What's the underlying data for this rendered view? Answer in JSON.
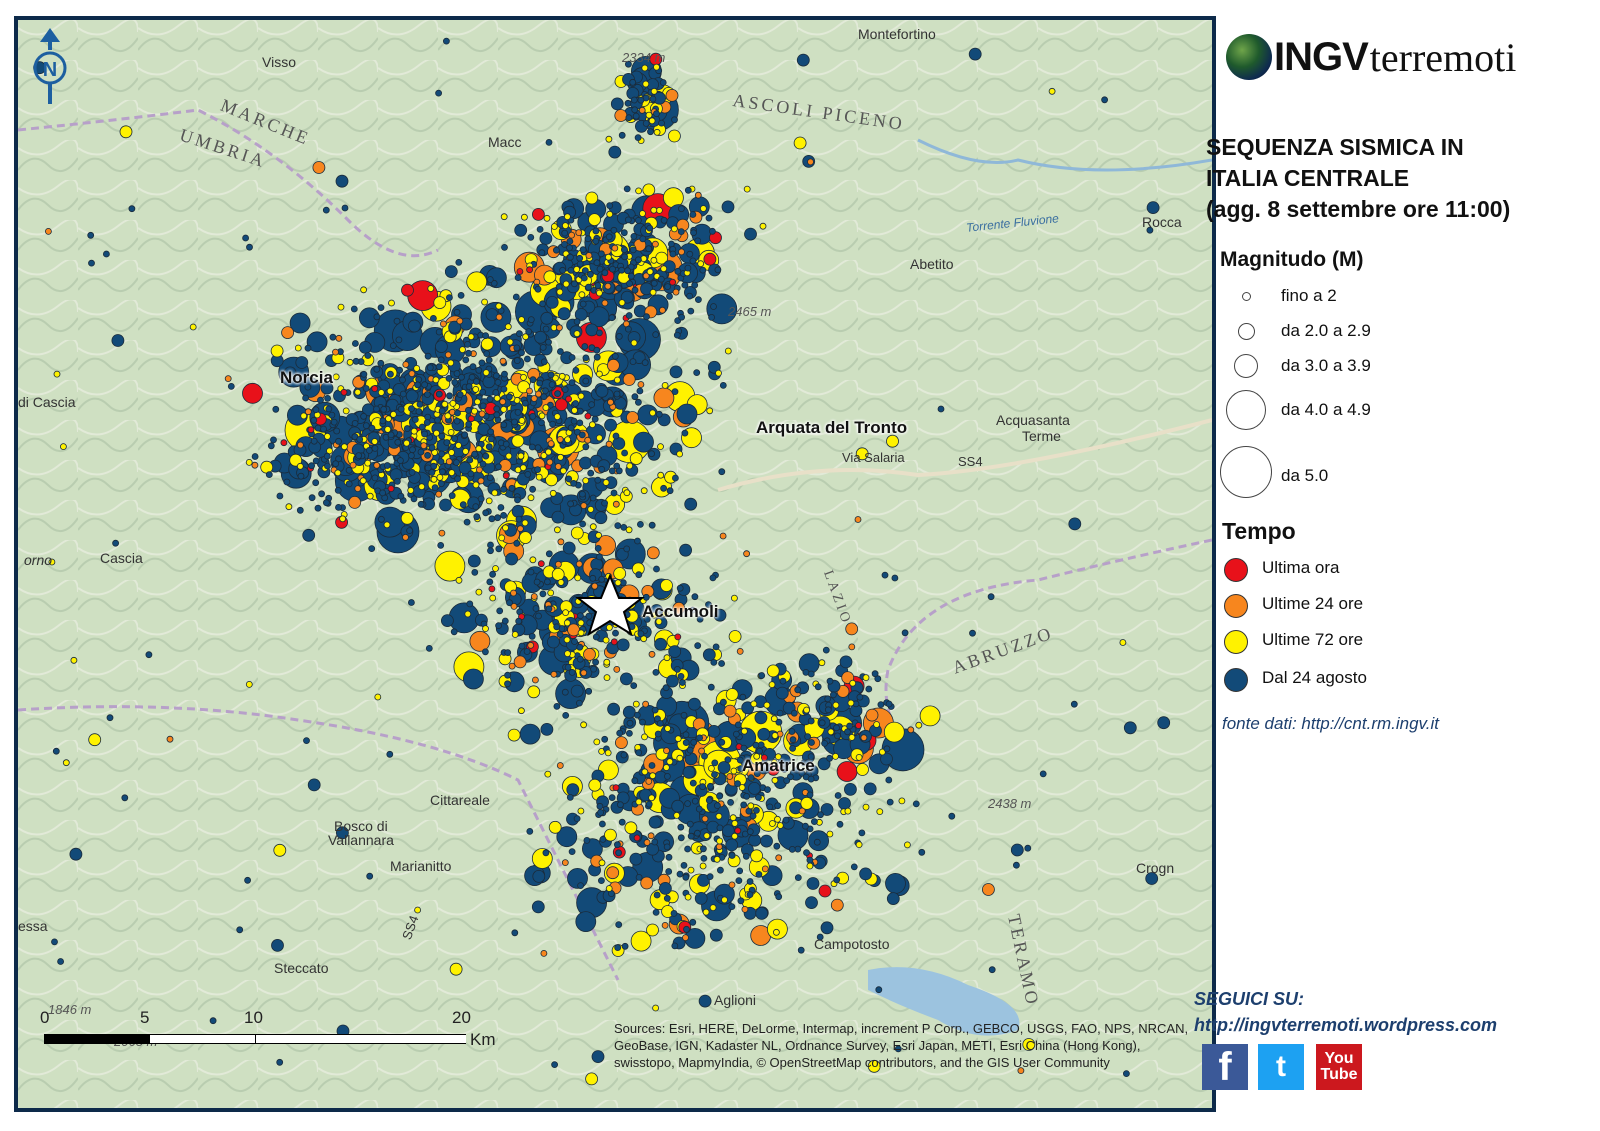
{
  "logo": {
    "prefix": "INGV",
    "suffix": "terremoti"
  },
  "title_lines": [
    "SEQUENZA SISMICA IN",
    "ITALIA CENTRALE",
    "(agg. 8 settembre ore 11:00)"
  ],
  "legend": {
    "magnitude_title": "Magnitudo (M)",
    "magnitude_classes": [
      "fino a 2",
      "da 2.0 a 2.9",
      "da 3.0 a 3.9",
      "da 4.0 a 4.9",
      "da 5.0"
    ],
    "time_title": "Tempo",
    "time_classes": [
      {
        "label": "Ultima ora",
        "color": "#e8111a"
      },
      {
        "label": "Ultime 24 ore",
        "color": "#f7861e"
      },
      {
        "label": "Ultime 72 ore",
        "color": "#fff200"
      },
      {
        "label": "Dal 24 agosto",
        "color": "#124a78"
      }
    ]
  },
  "source": "fonte dati: http://cnt.rm.ingv.it",
  "follow": {
    "label": "SEGUICI SU:",
    "url": "http://ingvterremoti.wordpress.com"
  },
  "social": {
    "facebook": "f",
    "twitter": "t",
    "youtube_top": "You",
    "youtube_bottom": "Tube"
  },
  "social_icons": [
    "facebook-icon",
    "twitter-icon",
    "youtube-icon"
  ],
  "map": {
    "north_label": "N",
    "places": {
      "norcia": "Norcia",
      "arquata": "Arquata del Tronto",
      "accumoli": "Accumoli",
      "amatrice": "Amatrice",
      "visso": "Visso",
      "montefortino": "Montefortino",
      "abetito": "Abetito",
      "acquasanta_1": "Acquasanta",
      "acquasanta_2": "Terme",
      "cascia": "Cascia",
      "cittareale": "Cittareale",
      "marianitto": "Marianitto",
      "steccato": "Steccato",
      "campotosto": "Campotosto",
      "aglioni": "Aglioni",
      "bosco_1": "Bosco di",
      "bosco_2": "Vallannara",
      "crogn": "Crogn",
      "rocca": "Rocca",
      "macc": "Macc",
      "essa": "essa",
      "di_cascia": "di Cascia",
      "orno": "orno"
    },
    "regions": {
      "marche": "MARCHE",
      "umbria": "UMBRIA",
      "ascoli": "ASCOLI PICENO",
      "abruzzo": "ABRUZZO",
      "teramo": "TERAMO",
      "lazio": "LAZIO"
    },
    "roads": {
      "salaria": "Via Salaria",
      "ss4": "SS4",
      "ss4b": "SS4"
    },
    "peaks": {
      "p1": "2465 m",
      "p2": "2438 m",
      "p3": "1846 m",
      "p4": "2065 m",
      "p5": "2334 m"
    },
    "rivers": {
      "fluvione": "Torrente Fluvione"
    },
    "scale": {
      "ticks": [
        "0",
        "5",
        "10",
        "20"
      ],
      "unit": "Km"
    },
    "attribution": "Sources: Esri, HERE, DeLorme, Intermap, increment P Corp., GEBCO, USGS, FAO, NPS, NRCAN, GeoBase, IGN, Kadaster NL, Ordnance Survey, Esri Japan, METI, Esri China (Hong Kong), swisstopo, MapmyIndia, © OpenStreetMap contributors, and the GIS User Community"
  }
}
